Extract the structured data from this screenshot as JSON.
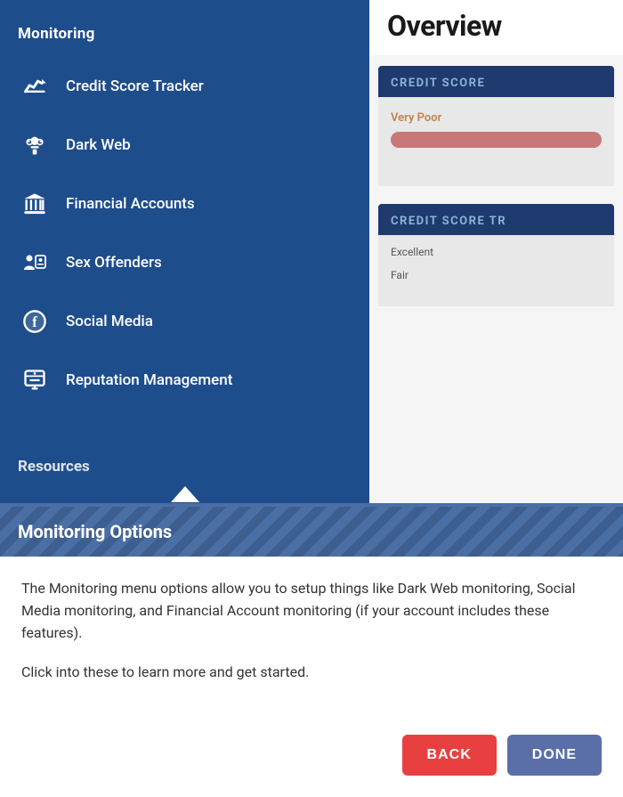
{
  "sidebar": {
    "section_title": "Monitoring",
    "items": [
      {
        "id": "credit-score-tracker",
        "label": "Credit Score Tracker",
        "icon": "chart-icon"
      },
      {
        "id": "dark-web",
        "label": "Dark Web",
        "icon": "spy-icon"
      },
      {
        "id": "financial-accounts",
        "label": "Financial Accounts",
        "icon": "bank-icon"
      },
      {
        "id": "sex-offenders",
        "label": "Sex Offenders",
        "icon": "person-badge-icon"
      },
      {
        "id": "social-media",
        "label": "Social Media",
        "icon": "social-icon"
      },
      {
        "id": "reputation-management",
        "label": "Reputation Management",
        "icon": "reputation-icon"
      }
    ],
    "resources_label": "Resources"
  },
  "right_panel": {
    "title": "Overview",
    "credit_score": {
      "label": "CREDIT SCORE",
      "very_poor_label": "Very Poor"
    },
    "credit_score_tracker": {
      "label": "CREDIT SCORE TR",
      "excellent_label": "Excellent",
      "fair_label": "Fair"
    }
  },
  "tooltip": {
    "title": "Monitoring Options",
    "paragraph1": "The Monitoring menu options allow you to setup things like Dark Web monitoring, Social Media monitoring, and Financial Account monitoring (if your account includes these features).",
    "paragraph2": "Click into these to learn more and get started.",
    "back_label": "BACK",
    "done_label": "DONE"
  }
}
